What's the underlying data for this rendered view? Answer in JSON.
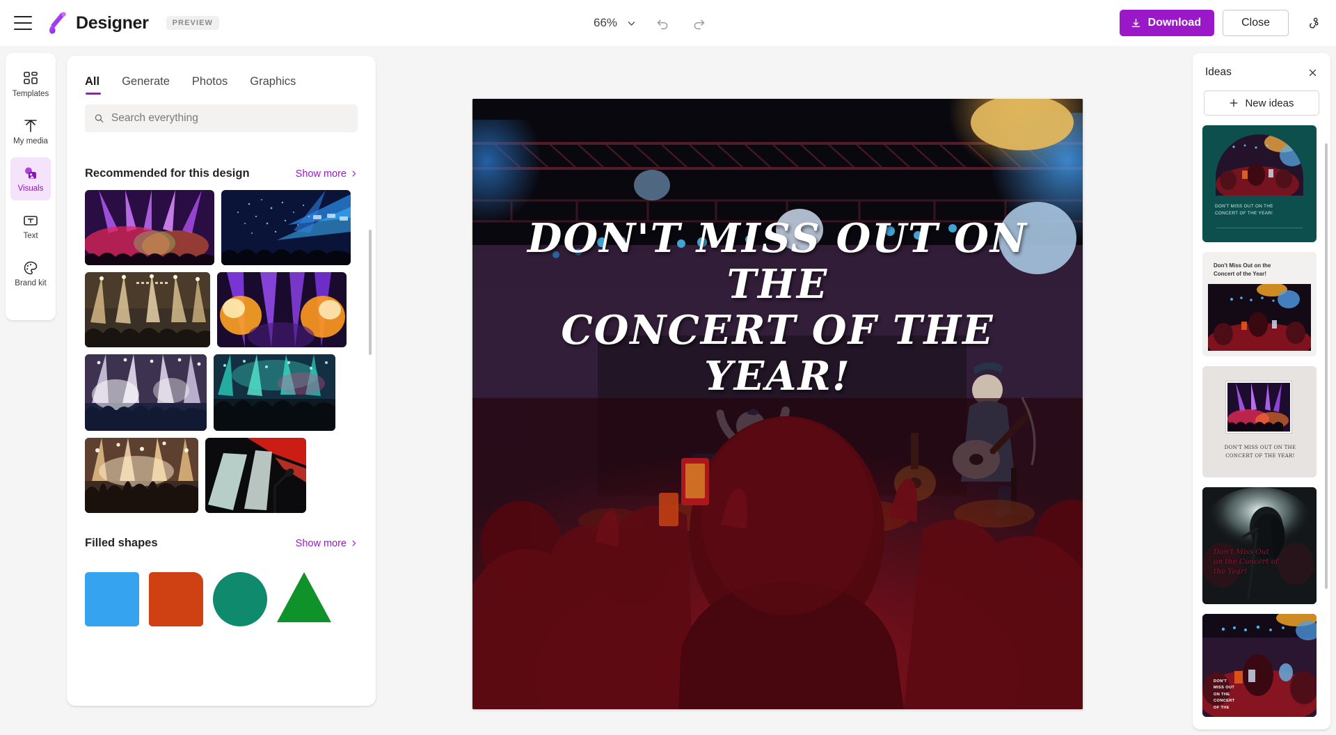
{
  "app": {
    "name": "Designer",
    "badge": "PREVIEW",
    "menu_icon": "hamburger-menu-icon",
    "logo_icon": "designer-logo-icon"
  },
  "topbar": {
    "zoom_level": "66%",
    "zoom_chevron_icon": "chevron-down-icon",
    "undo_icon": "undo-icon",
    "redo_icon": "redo-icon",
    "download_label": "Download",
    "download_icon": "download-icon",
    "download_color": "#9b18c9",
    "close_label": "Close",
    "share_icon": "share-icon"
  },
  "sidebar": {
    "items": [
      {
        "label": "Templates",
        "icon": "templates-grid-icon",
        "active": false
      },
      {
        "label": "My media",
        "icon": "upload-arrow-icon",
        "active": false
      },
      {
        "label": "Visuals",
        "icon": "visuals-bubbles-icon",
        "active": true
      },
      {
        "label": "Text",
        "icon": "text-box-icon",
        "active": false
      },
      {
        "label": "Brand kit",
        "icon": "palette-icon",
        "active": false
      }
    ],
    "active_color": "#8a15b8",
    "active_bg": "#f5e3fb"
  },
  "panel": {
    "tabs": [
      {
        "label": "All",
        "active": true
      },
      {
        "label": "Generate",
        "active": false
      },
      {
        "label": "Photos",
        "active": false
      },
      {
        "label": "Graphics",
        "active": false
      }
    ],
    "search": {
      "placeholder": "Search everything",
      "value": "",
      "icon": "search-icon"
    },
    "sections": [
      {
        "title": "Recommended for this design",
        "show_more": "Show more",
        "show_more_icon": "chevron-right-icon",
        "photos": [
          {
            "name": "purple-stage-lights-crowd"
          },
          {
            "name": "blue-confetti-stage"
          },
          {
            "name": "golden-spotlight-crowd"
          },
          {
            "name": "orange-purple-stage-beams"
          },
          {
            "name": "white-light-concert-crowd"
          },
          {
            "name": "teal-festival-crowd"
          },
          {
            "name": "warm-lights-raised-hands"
          },
          {
            "name": "microphone-red-stage"
          }
        ]
      },
      {
        "title": "Filled shapes",
        "show_more": "Show more",
        "show_more_icon": "chevron-right-icon",
        "shapes": [
          {
            "name": "filled-square",
            "color": "#35a3ef"
          },
          {
            "name": "filled-rounded-square",
            "color": "#cf4112"
          },
          {
            "name": "filled-circle",
            "color": "#0f8a6d"
          },
          {
            "name": "filled-triangle",
            "color": "#10922a"
          }
        ]
      }
    ]
  },
  "canvas": {
    "headline": "DON'T MISS OUT ON THE\nCONCERT OF THE YEAR!",
    "image_name": "concert-crowd-stage-photo",
    "zoom": "66%"
  },
  "ideas": {
    "title": "Ideas",
    "close_icon": "close-icon",
    "new_ideas_label": "New ideas",
    "new_ideas_icon": "plus-icon",
    "cards": [
      {
        "name": "idea-teal-arch",
        "caption": "DON'T MISS OUT ON THE\nCONCERT OF THE YEAR!",
        "bg": "#0c4f4c"
      },
      {
        "name": "idea-white-top-text",
        "caption": "Don't Miss Out on the\nConcert of the Year!",
        "bg": "#f2f1f0"
      },
      {
        "name": "idea-grey-framed-serif",
        "caption": "DON'T MISS OUT ON THE\nCONCERT OF THE YEAR!",
        "bg": "#e6e3e1"
      },
      {
        "name": "idea-dark-singer-script",
        "caption": "Don't Miss Out\non the Concert of\nthe Year!",
        "bg": "#14171a"
      },
      {
        "name": "idea-photo-corner-caption",
        "caption": "DON'T\nMISS OUT\nON THE\nCONCERT\nOF THE",
        "bg": "#1a0d12"
      }
    ]
  }
}
